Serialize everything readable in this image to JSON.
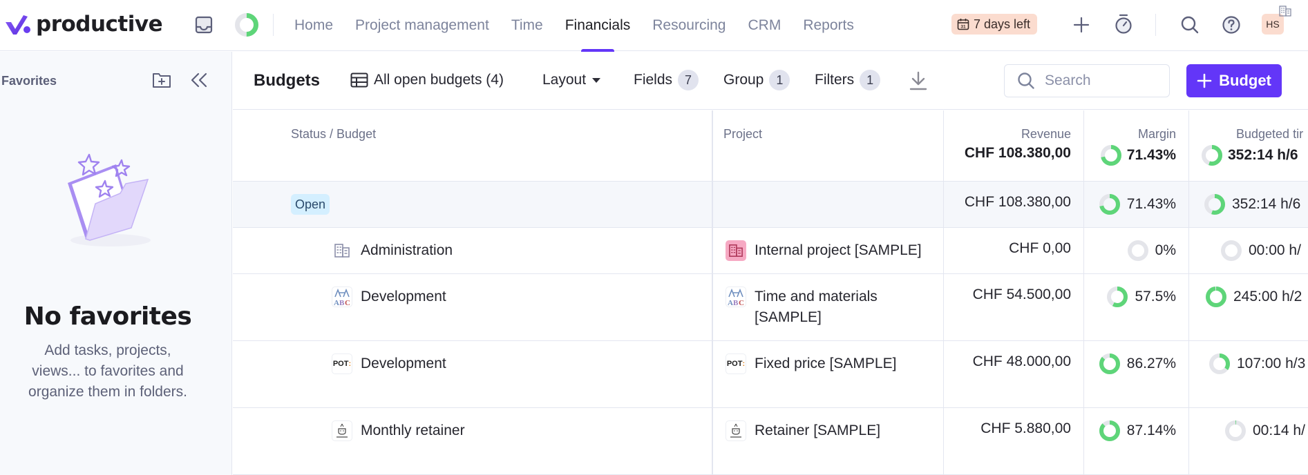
{
  "app": {
    "brand": "productive",
    "accent_color": "#6336f8",
    "positive_color": "#5ed579",
    "track_color": "#e4e5ea"
  },
  "topbar": {
    "onboarding_progress": 0.5,
    "nav": [
      {
        "label": "Home",
        "active": false
      },
      {
        "label": "Project management",
        "active": false
      },
      {
        "label": "Time",
        "active": false
      },
      {
        "label": "Financials",
        "active": true
      },
      {
        "label": "Resourcing",
        "active": false
      },
      {
        "label": "CRM",
        "active": false
      },
      {
        "label": "Reports",
        "active": false
      }
    ],
    "trial_label": "7 days left",
    "trial_icon": "calendar-icon",
    "avatar_initials": "HS"
  },
  "sidebar": {
    "title": "Favorites",
    "empty_title": "No favorites",
    "empty_description": "Add tasks, projects, views... to favorites and organize them in folders."
  },
  "toolbar": {
    "title": "Budgets",
    "view_label": "All open budgets (4)",
    "layout_label": "Layout",
    "fields_label": "Fields",
    "fields_count": "7",
    "group_label": "Group",
    "group_count": "1",
    "filters_label": "Filters",
    "filters_count": "1",
    "search_placeholder": "Search",
    "add_budget_label": "Budget"
  },
  "table": {
    "columns": {
      "status": "Status / Budget",
      "project": "Project",
      "revenue": "Revenue",
      "margin": "Margin",
      "budgeted_time": "Budgeted tir"
    },
    "totals": {
      "revenue": "CHF 108.380,00",
      "margin": "71.43%",
      "margin_fraction": 0.7143,
      "budgeted_time": "352:14 h/6",
      "budgeted_time_fraction": 0.55
    },
    "group": {
      "status": "Open",
      "revenue": "CHF 108.380,00",
      "margin": "71.43%",
      "margin_fraction": 0.7143,
      "budgeted_time": "352:14 h/6",
      "budgeted_time_fraction": 0.55
    },
    "rows": [
      {
        "budget": "Administration",
        "budget_icon": "building-icon",
        "project": "Internal project [SAMPLE]",
        "project_icon": "building-icon",
        "revenue": "CHF 0,00",
        "margin": "0%",
        "margin_fraction": 0,
        "budgeted_time": "00:00 h/",
        "budgeted_time_fraction": 0
      },
      {
        "budget": "Development",
        "budget_icon": "abc-logo-icon",
        "project": "Time and materials [SAMPLE]",
        "project_icon": "abc-logo-icon",
        "revenue": "CHF 54.500,00",
        "margin": "57.5%",
        "margin_fraction": 0.575,
        "budgeted_time": "245:00 h/2",
        "budgeted_time_fraction": 0.98
      },
      {
        "budget": "Development",
        "budget_icon": "pot-logo-icon",
        "project": "Fixed price [SAMPLE]",
        "project_icon": "pot-logo-icon",
        "revenue": "CHF 48.000,00",
        "margin": "86.27%",
        "margin_fraction": 0.8627,
        "budgeted_time": "107:00 h/3",
        "budgeted_time_fraction": 0.35
      },
      {
        "budget": "Monthly retainer",
        "budget_icon": "coffee-logo-icon",
        "project": "Retainer [SAMPLE]",
        "project_icon": "coffee-logo-icon",
        "revenue": "CHF 5.880,00",
        "margin": "87.14%",
        "margin_fraction": 0.8714,
        "budgeted_time": "00:14 h/",
        "budgeted_time_fraction": 0.01
      }
    ]
  }
}
